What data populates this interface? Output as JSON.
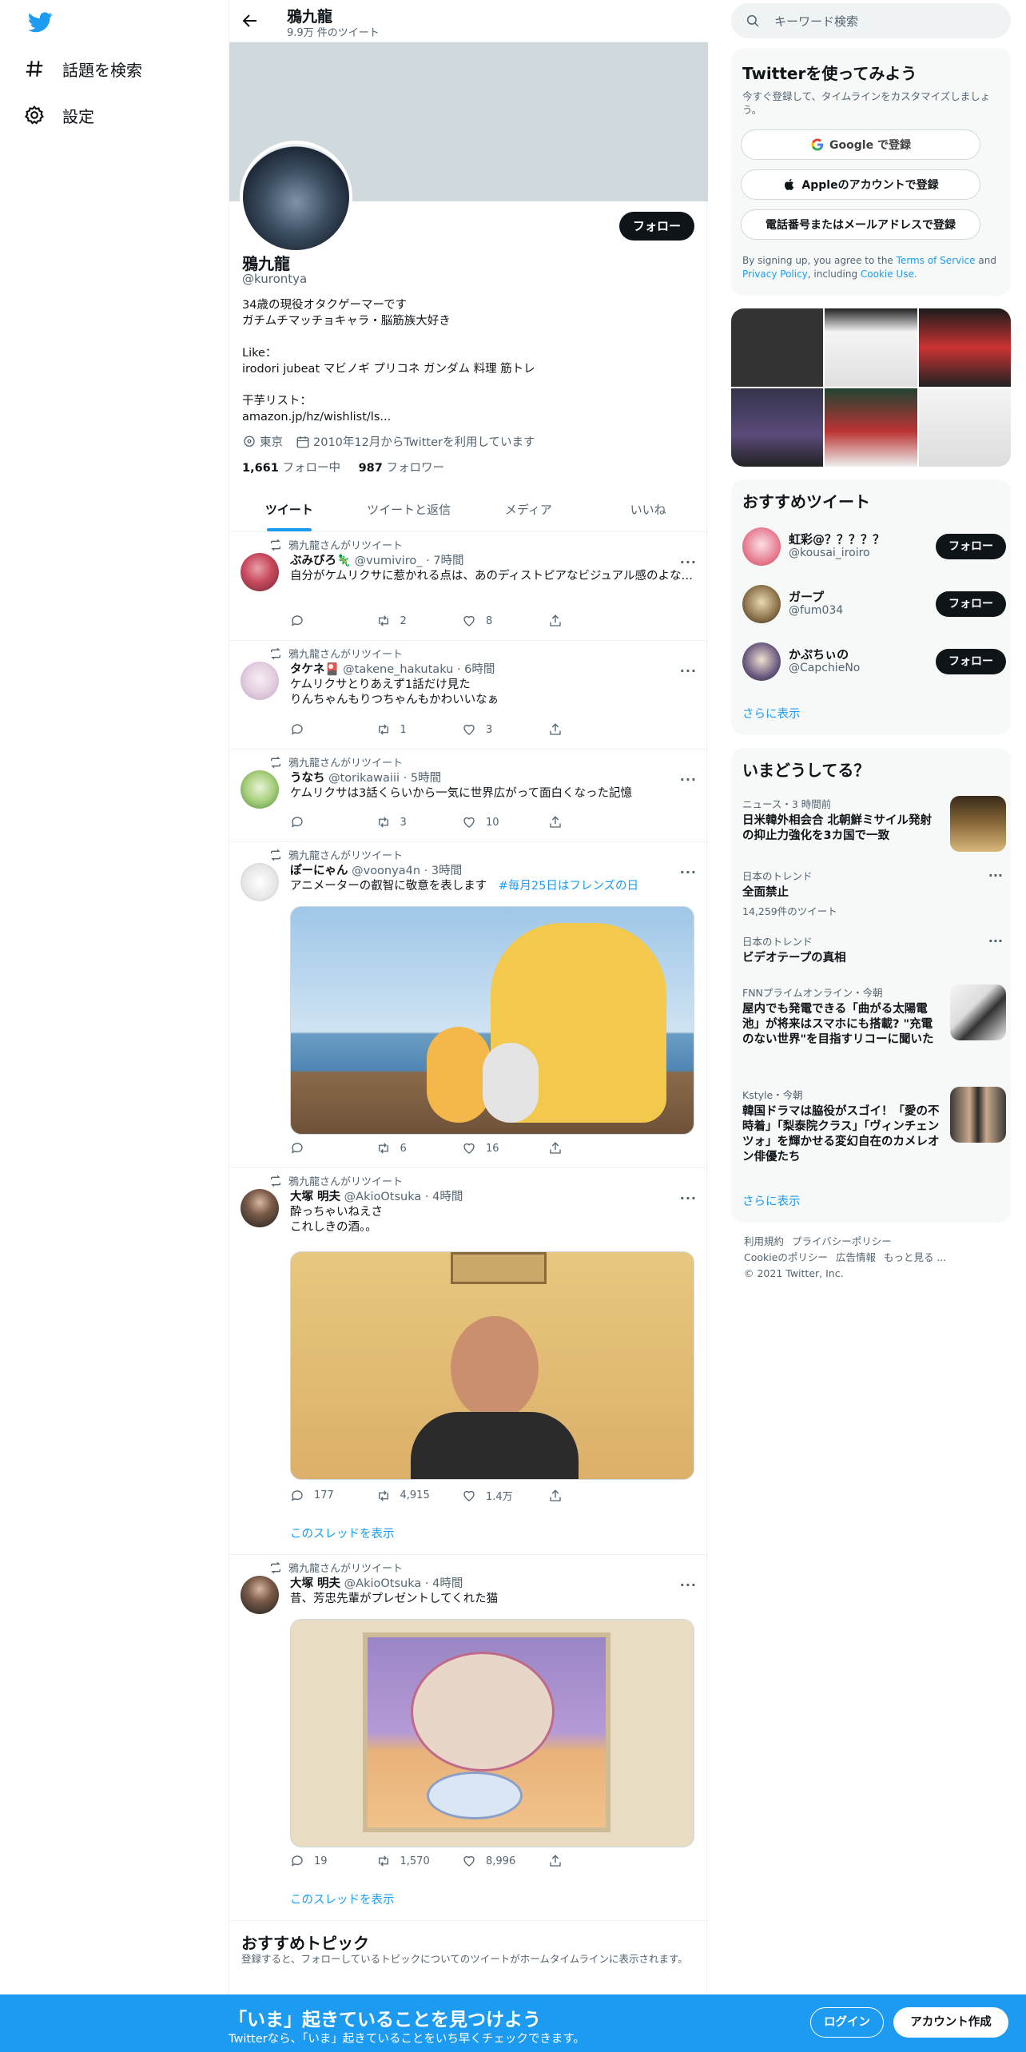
{
  "nav": {
    "explore_label": "話題を検索",
    "settings_label": "設定"
  },
  "header": {
    "name": "鴉九龍",
    "tweet_count": "9.9万 件のツイート"
  },
  "profile": {
    "name": "鴉九龍",
    "handle": "@kurontya",
    "follow_label": "フォロー",
    "bio_line1": "34歳の現役オタクゲーマーです",
    "bio_line2": "ガチムチマッチョキャラ・脳筋族大好き",
    "like_label": "Like：",
    "like_text": "irodori jubeat マビノギ プリコネ ガンダム 料理 筋トレ",
    "wishlist_label": "干芋リスト：",
    "wishlist_link": "amazon.jp/hz/wishlist/ls...",
    "location": "東京",
    "joined": "2010年12月からTwitterを利用しています",
    "following_count": "1,661",
    "following_label": "フォロー中",
    "followers_count": "987",
    "followers_label": "フォロワー"
  },
  "tabs": [
    "ツイート",
    "ツイートと返信",
    "メディア",
    "いいね"
  ],
  "tweets": [
    {
      "retweeted_by": "鴉九龍さんがリツイート",
      "name": "ぶみびろ🦎",
      "handle": "@vumiviro_",
      "time": "7時間",
      "text": "自分がケムリクサに惹かれる点は、あのディストピアなビジュアル感のよな…",
      "replies": "",
      "retweets": "2",
      "likes": "8"
    },
    {
      "retweeted_by": "鴉九龍さんがリツイート",
      "name": "タケネ🎴",
      "handle": "@takene_hakutaku",
      "time": "6時間",
      "text": "ケムリクサとりあえず1話だけ見た\nりんちゃんもりつちゃんもかわいいなぁ",
      "replies": "",
      "retweets": "1",
      "likes": "3"
    },
    {
      "retweeted_by": "鴉九龍さんがリツイート",
      "name": "うなち",
      "handle": "@torikawaiii",
      "time": "5時間",
      "text": "ケムリクサは3話くらいから一気に世界広がって面白くなった記憶",
      "replies": "",
      "retweets": "3",
      "likes": "10"
    },
    {
      "retweeted_by": "鴉九龍さんがリツイート",
      "name": "ぽーにゃん",
      "handle": "@voonya4n",
      "time": "3時間",
      "text": "アニメーターの叡智に敬意を表します",
      "hashtag": "#毎月25日はフレンズの日",
      "replies": "",
      "retweets": "6",
      "likes": "16"
    },
    {
      "retweeted_by": "鴉九龍さんがリツイート",
      "name": "大塚 明夫",
      "handle": "@AkioOtsuka",
      "time": "4時間",
      "text": "酔っちゃいねえさ\nこれしきの酒。。",
      "replies": "177",
      "retweets": "4,915",
      "likes": "1.4万",
      "thread": "このスレッドを表示"
    },
    {
      "retweeted_by": "鴉九龍さんがリツイート",
      "name": "大塚 明夫",
      "handle": "@AkioOtsuka",
      "time": "4時間",
      "text": "昔、芳忠先輩がプレゼントしてくれた猫",
      "replies": "19",
      "retweets": "1,570",
      "likes": "8,996",
      "thread": "このスレッドを表示"
    }
  ],
  "topics": {
    "title": "おすすめトピック",
    "desc": "登録すると、フォローしているトピックについてのツイートがホームタイムラインに表示されます。"
  },
  "search": {
    "placeholder": "キーワード検索"
  },
  "signup_card": {
    "title": "Twitterを使ってみよう",
    "desc": "今すぐ登録して、タイムラインをカスタマイズしましょう。",
    "google": "Google で登録",
    "apple": "Appleのアカウントで登録",
    "phone": "電話番号またはメールアドレスで登録",
    "legal_pre": "By signing up, you agree to the",
    "terms": "Terms of Service",
    "and": "and",
    "privacy": "Privacy Policy",
    "including": ", including",
    "cookie": "Cookie Use."
  },
  "who_to_follow": {
    "title": "おすすめツイート",
    "users": [
      {
        "name": "虹彩@？？？？？",
        "handle": "@kousai_iroiro"
      },
      {
        "name": "ガープ",
        "handle": "@fum034"
      },
      {
        "name": "かぷちぃの",
        "handle": "@CapchieNo"
      }
    ],
    "follow_label": "フォロー",
    "more": "さらに表示"
  },
  "trends": {
    "title": "いまどうしてる？",
    "items": [
      {
        "meta": "ニュース・3 時間前",
        "title": "日米韓外相会合 北朝鮮ミサイル発射の抑止力強化を3カ国で一致"
      },
      {
        "meta": "日本のトレンド",
        "title": "全面禁止",
        "count": "14,259件のツイート"
      },
      {
        "meta": "日本のトレンド",
        "title": "ビデオテープの真相"
      },
      {
        "meta": "FNNプライムオンライン・今朝",
        "title": "屋内でも発電できる「曲がる太陽電池」が将来はスマホにも搭載? \"充電のない世界\"を目指すリコーに聞いた"
      },
      {
        "meta": "Kstyle・今朝",
        "title": "韓国ドラマは脇役がスゴイ！「愛の不時着」「梨泰院クラス」「ヴィンチェンツォ」を輝かせる変幻自在のカメレオン俳優たち"
      }
    ],
    "more": "さらに表示"
  },
  "footer": {
    "links": [
      "利用規約",
      "プライバシーポリシー",
      "Cookieのポリシー",
      "広告情報",
      "もっと見る ..."
    ],
    "copyright": "© 2021 Twitter, Inc."
  },
  "bottom": {
    "title": "「いま」起きていることを見つけよう",
    "sub": "Twitterなら、「いま」起きていることをいち早くチェックできます。",
    "login": "ログイン",
    "signup": "アカウント作成"
  },
  "colors": {
    "accent": "#1d9bf0",
    "text": "#0f1419",
    "secondary": "#536471",
    "banner": "#cfd9de"
  }
}
